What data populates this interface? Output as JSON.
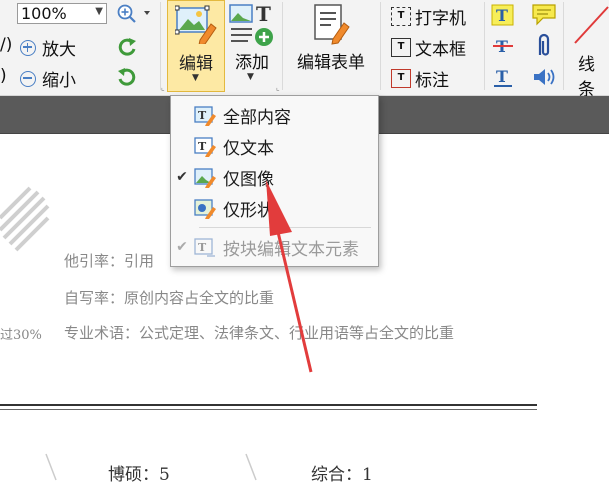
{
  "ribbon": {
    "zoom": {
      "value": "100%"
    },
    "zoom_in_label": "放大",
    "zoom_out_label": "缩小",
    "left_cut_top": "/)",
    "left_cut_bottom": ")",
    "edit_label": "编辑",
    "add_label": "添加",
    "edit_form_label": "编辑表单",
    "typewriter_label": "打字机",
    "textbox_label": "文本框",
    "callout_label": "标注",
    "line_label": "线条"
  },
  "menu": {
    "items": [
      {
        "label": "全部内容",
        "checked": false,
        "disabled": false
      },
      {
        "label": "仅文本",
        "checked": false,
        "disabled": false
      },
      {
        "label": "仅图像",
        "checked": true,
        "disabled": false
      },
      {
        "label": "仅形状",
        "checked": false,
        "disabled": false
      },
      {
        "label": "按块编辑文本元素",
        "checked": true,
        "disabled": true
      }
    ]
  },
  "document": {
    "line1": "他引率：引用",
    "line2": "自写率：原创内容占全文的比重",
    "line3_prefix": "过30%",
    "line3": "专业术语：公式定理、法律条文、行业用语等占全文的比重",
    "count1": "博硕：5",
    "count2": "综合：1"
  },
  "colors": {
    "accent": "#e3b93f",
    "arrow": "#e23c3c",
    "menu_bg": "#f8f8f8"
  }
}
